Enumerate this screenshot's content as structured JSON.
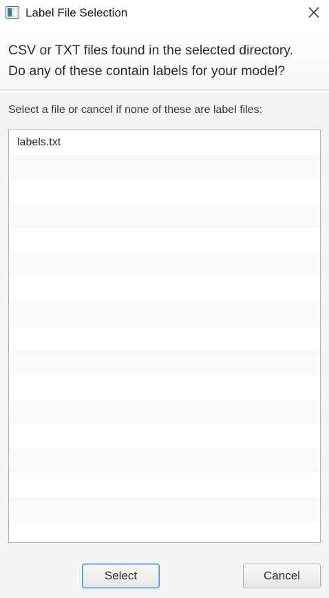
{
  "window": {
    "title": "Label File Selection"
  },
  "header": {
    "line1": "CSV or TXT files found in the selected directory.",
    "line2": "Do any of these contain labels for your model?"
  },
  "main": {
    "instruction": "Select a file or cancel if none of these are label files:",
    "files": [
      "labels.txt",
      "",
      "",
      "",
      "",
      "",
      "",
      "",
      "",
      "",
      "",
      "",
      "",
      "",
      "",
      "",
      ""
    ]
  },
  "buttons": {
    "select_label": "Select",
    "cancel_label": "Cancel"
  },
  "colors": {
    "focus_border": "#3a8fd8",
    "alt_row": "#f9f9f9"
  },
  "icons": {
    "app": "window-app-icon",
    "close": "close-icon"
  }
}
